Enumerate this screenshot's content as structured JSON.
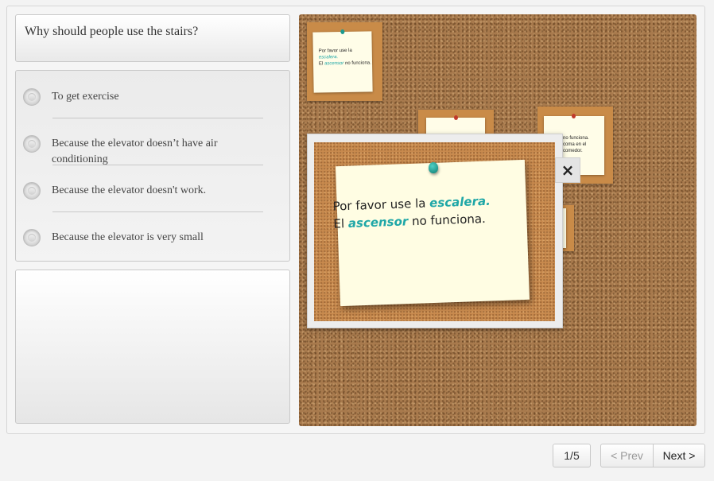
{
  "question": {
    "text": "Why should people use the stairs?"
  },
  "answers": [
    {
      "label": "To get exercise"
    },
    {
      "label": "Because the elevator doesn’t have air conditioning"
    },
    {
      "label": "Because the elevator doesn't work."
    },
    {
      "label": "Because the elevator is very small"
    }
  ],
  "thumbnail": {
    "line1a": "Por favor use la ",
    "line1b": "escalera.",
    "line2a": "El ",
    "line2b": "ascensor",
    "line2c": " no funciona.",
    "other_line1": "no funciona.",
    "other_line2": "coma en el comedor."
  },
  "popup_note": {
    "line1_plain": "Por favor use la ",
    "line1_highlight": "escalera.",
    "line2_plain_start": "El ",
    "line2_highlight": "ascensor",
    "line2_plain_end": " no funciona."
  },
  "popup": {
    "close_icon": "×"
  },
  "pagination": {
    "page_indicator": "1/5",
    "prev_label": "< Prev",
    "next_label": "Next >"
  },
  "colors": {
    "accent_teal": "#1fa7a7",
    "cork": "#a87a4d"
  }
}
